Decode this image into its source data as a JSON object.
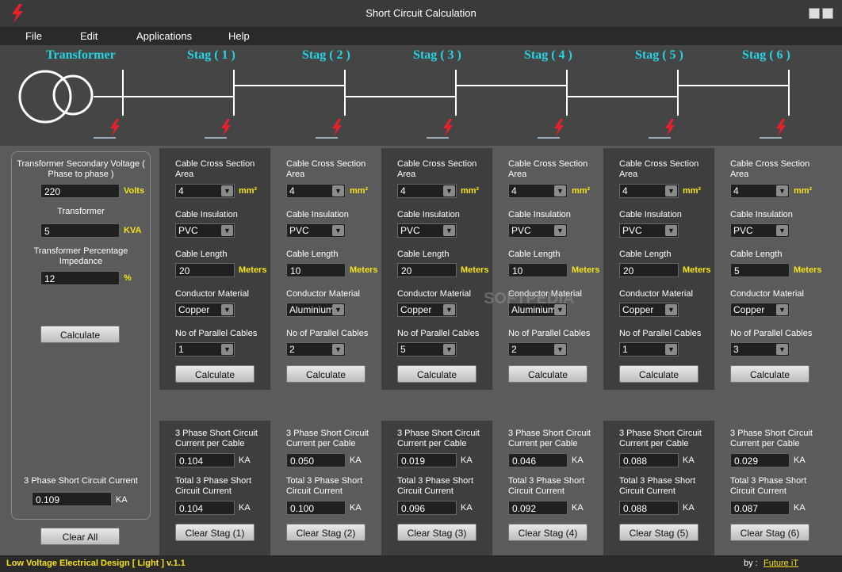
{
  "window": {
    "title": "Short Circuit Calculation"
  },
  "menu": [
    "File",
    "Edit",
    "Applications",
    "Help"
  ],
  "diagram": {
    "labels": [
      "Transformer",
      "Stag ( 1 )",
      "Stag ( 2 )",
      "Stag ( 3 )",
      "Stag ( 4 )",
      "Stag ( 5 )",
      "Stag ( 6 )"
    ]
  },
  "left": {
    "voltage_label": "Transformer Secondary Voltage ( Phase to phase )",
    "voltage_value": "220",
    "voltage_unit": "Volts",
    "transformer_label": "Transformer",
    "transformer_value": "5",
    "transformer_unit": "KVA",
    "impedance_label": "Transformer Percentage Impedance",
    "impedance_value": "12",
    "impedance_unit": "%",
    "calculate": "Calculate",
    "sc_label": "3 Phase Short Circuit Current",
    "sc_value": "0.109",
    "sc_unit": "KA",
    "clear_all": "Clear All"
  },
  "labels": {
    "cross_section": "Cable Cross Section Area",
    "mm2": "mm²",
    "insulation": "Cable Insulation",
    "length": "Cable Length",
    "meters": "Meters",
    "material": "Conductor Material",
    "parallel": "No of Parallel Cables",
    "calculate": "Calculate",
    "per_cable": "3 Phase Short Circuit Current per Cable",
    "total": "Total 3 Phase Short Circuit Current",
    "ka": "KA"
  },
  "stags": [
    {
      "area": "4",
      "insulation": "PVC",
      "length": "20",
      "material": "Copper",
      "parallel": "1",
      "per_cable": "0.104",
      "total": "0.104",
      "clear": "Clear Stag (1)"
    },
    {
      "area": "4",
      "insulation": "PVC",
      "length": "10",
      "material": "Aluminium",
      "parallel": "2",
      "per_cable": "0.050",
      "total": "0.100",
      "clear": "Clear Stag (2)"
    },
    {
      "area": "4",
      "insulation": "PVC",
      "length": "20",
      "material": "Copper",
      "parallel": "5",
      "per_cable": "0.019",
      "total": "0.096",
      "clear": "Clear Stag (3)"
    },
    {
      "area": "4",
      "insulation": "PVC",
      "length": "10",
      "material": "Aluminium",
      "parallel": "2",
      "per_cable": "0.046",
      "total": "0.092",
      "clear": "Clear Stag (4)"
    },
    {
      "area": "4",
      "insulation": "PVC",
      "length": "20",
      "material": "Copper",
      "parallel": "1",
      "per_cable": "0.088",
      "total": "0.088",
      "clear": "Clear Stag (5)"
    },
    {
      "area": "4",
      "insulation": "PVC",
      "length": "5",
      "material": "Copper",
      "parallel": "3",
      "per_cable": "0.029",
      "total": "0.087",
      "clear": "Clear Stag (6)"
    }
  ],
  "status": {
    "app": "Low Voltage Electrical Design [ Light ]  v.1.1",
    "by": "by :",
    "link": "Future iT"
  },
  "watermark": "SOFTPEDIA",
  "colors": {
    "accent_yellow": "#f5e21a",
    "accent_cyan": "#27d3e3",
    "bolt_red": "#e8202a"
  }
}
